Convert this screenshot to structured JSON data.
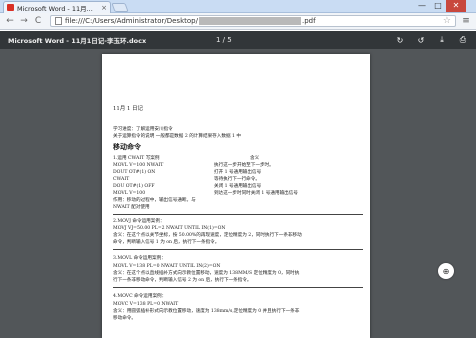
{
  "browser": {
    "tab_title": "Microsoft Word - 11月...",
    "tab_close": "×",
    "window_controls": [
      "—",
      "□",
      "✕"
    ],
    "nav": {
      "back": "←",
      "forward": "→",
      "reload": "C"
    },
    "address_prefix": "file:///C:/Users/Administrator/Desktop/",
    "address_suffix": ".pdf",
    "star": "☆",
    "menu": "≡"
  },
  "pdf_viewer": {
    "title": "Microsoft Word - 11月1日记-李玉环.docx",
    "page_indicator": "1 / 5",
    "actions": [
      "↻",
      "↺",
      "⤓",
      "⎙"
    ],
    "zoom_icon": "⊕"
  },
  "document": {
    "date": "11月 1 日记",
    "progress": "学习进度：了解运用安川指令",
    "intro": "关于运算指令的说明 一般都是数据 2 的计算结果存入数据 1 中",
    "section1": "移动命令",
    "list_header_left": "1.运用 CWAIT 写案例",
    "list_header_right": "含义",
    "rows": [
      {
        "cmd": "MOVL V=100 NWAIT",
        "meaning": "执行这一步开始至下一步时。"
      },
      {
        "cmd": "DOUT OT#(1) ON",
        "meaning": "打开 1 号通用输出信号"
      },
      {
        "cmd": "CWAIT",
        "meaning": "等待执行下一行命令。"
      },
      {
        "cmd": "DOU OT#(1) OFF",
        "meaning": "关闭 1 号通用输出信号"
      },
      {
        "cmd": "MOVL V=100",
        "meaning": "到达这一步时同时关闭 1 号通用输出信号"
      }
    ],
    "note1": "作用：移动的过程中，输出信号通断。与",
    "note2": "NWAIT 配对使用",
    "case2_title": "2.MOVJ 命令运用案例：",
    "case2_cmd": "MOVJ    VJ=50.00   PL=2    NWAIT    UNTIL    IN(1)=ON",
    "case2_desc1": "含义：在这个点以关节坐标，按 50.00%的再现速度，定位精度为 2，同时执行下一条非移动",
    "case2_desc2": "命令，判断输入信号 1 为 on 后，执行下一条指令。",
    "case3_title": "3.MOVL 命令运用案例：",
    "case3_cmd": "MOVL     V=138    PL=0     NWAIT    UNTIL     IN(2)=ON",
    "case3_desc1": "含义：在这个点以直线插补方式向示教位置移动，速度为 138MM/S 定位精度为 0，同时执",
    "case3_desc2": "行下一条非移动命令，判断输入信号 2 为 on 后，执行下一条指令。",
    "case4_title": "4.MOVC 命令运用案例：",
    "case4_cmd": "MOVC      V=138     PL=0       NWAIT",
    "case4_desc1": "含义：用圆弧插补形式向示教位置移动，速度为 138mm/s,定位精度为 0 并且执行下一条非",
    "case4_desc2": "移动命令。"
  }
}
